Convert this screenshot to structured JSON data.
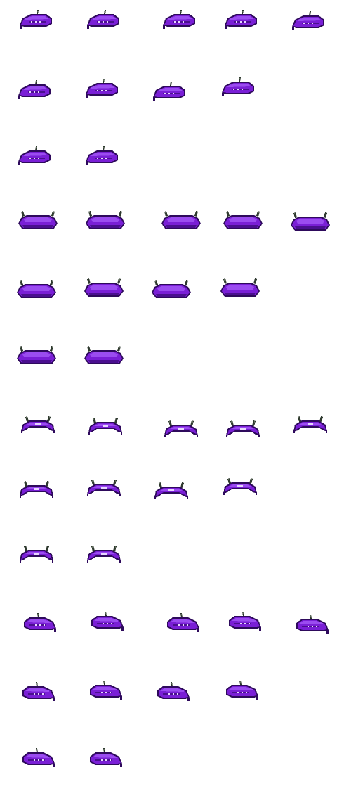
{
  "sheet": {
    "type": "sprite-sheet",
    "background": "#ffffff",
    "palette": {
      "body": "#7a1fd6",
      "body_dark": "#4a0f8f",
      "highlight": "#9b4cf0",
      "outline": "#2e0a5c",
      "window": "#e7d6ff",
      "horn": "#2f3a2f",
      "horn_light": "#5d6b58"
    },
    "animations": [
      {
        "view": "side-left",
        "frame_count": 11
      },
      {
        "view": "back",
        "frame_count": 11
      },
      {
        "view": "front",
        "frame_count": 11
      },
      {
        "view": "side-right",
        "frame_count": 11
      }
    ]
  }
}
